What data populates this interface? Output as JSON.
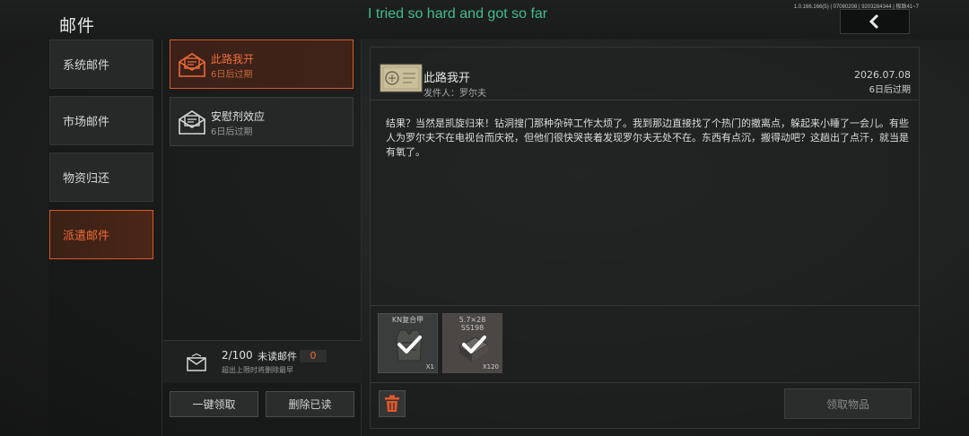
{
  "header": {
    "title": "邮件",
    "lyric": "I tried so hard and got so far",
    "version": "1.0.166.166(5) | 07080208 | 9203284344 | 极致41~7",
    "back_icon": "chevron-left-icon"
  },
  "categories": [
    {
      "label": "系统邮件",
      "active": false
    },
    {
      "label": "市场邮件",
      "active": false
    },
    {
      "label": "物资归还",
      "active": false
    },
    {
      "label": "派遣邮件",
      "active": true
    }
  ],
  "mail_list": [
    {
      "subject": "此路我开",
      "expiry": "6日后过期",
      "active": true,
      "icon": "envelope-open-icon"
    },
    {
      "subject": "安慰剂效应",
      "expiry": "6日后过期",
      "active": false,
      "icon": "envelope-open-icon"
    }
  ],
  "summary": {
    "count": "2/100",
    "unread_label": "未读邮件",
    "unread_count": "0",
    "hint": "超出上限时将删除最早",
    "icon": "envelope-icon"
  },
  "list_buttons": {
    "claim_all": "一键领取",
    "delete_read": "删除已读"
  },
  "detail": {
    "title": "此路我开",
    "sender_label": "发件人：",
    "sender": "罗尔夫",
    "date": "2026.07.08",
    "expiry": "6日后过期",
    "body": "结果？当然是凯旋归来！钻洞搜门那种杂碎工作太烦了。我到那边直接找了个热门的撤离点，躲起来小睡了一会儿。有些人为罗尔夫不在电视台而庆祝，但他们很快哭丧着发现罗尔夫无处不在。东西有点沉，搬得动吧？这趟出了点汗，就当是有氧了。",
    "attachments": [
      {
        "name": "KN复合甲",
        "qty": "X1",
        "icon": "armor-vest-icon"
      },
      {
        "name": "5.7×28\nSS198",
        "qty": "X120",
        "icon": "ammo-box-icon"
      }
    ],
    "delete_icon": "trash-icon",
    "claim_button": "领取物品"
  },
  "colors": {
    "accent": "#e0582a",
    "lyric": "#3fbf8b",
    "trash": "#e2572a"
  }
}
